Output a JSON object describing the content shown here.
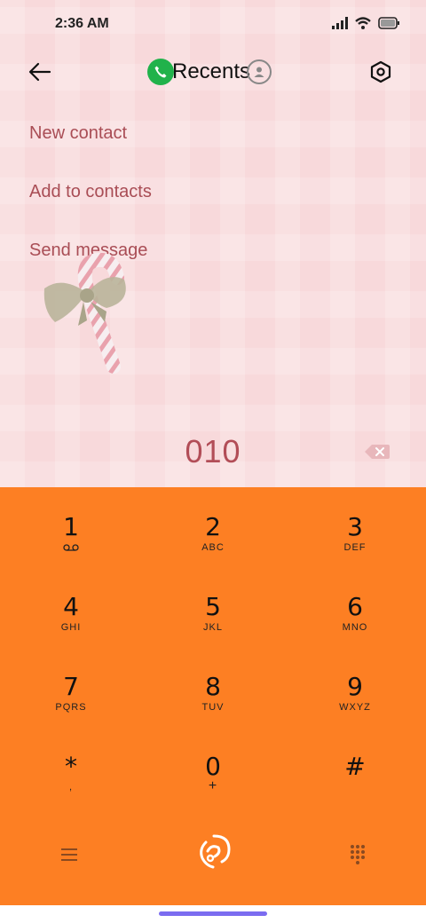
{
  "status": {
    "time": "2:36 AM"
  },
  "toolbar": {
    "title": "Recents"
  },
  "menu": {
    "items": [
      "New contact",
      "Add to contacts",
      "Send message"
    ]
  },
  "dialer": {
    "number": "010"
  },
  "keypad": {
    "keys": [
      {
        "digit": "1",
        "letters": ""
      },
      {
        "digit": "2",
        "letters": "ABC"
      },
      {
        "digit": "3",
        "letters": "DEF"
      },
      {
        "digit": "4",
        "letters": "GHI"
      },
      {
        "digit": "5",
        "letters": "JKL"
      },
      {
        "digit": "6",
        "letters": "MNO"
      },
      {
        "digit": "7",
        "letters": "PQRS"
      },
      {
        "digit": "8",
        "letters": "TUV"
      },
      {
        "digit": "9",
        "letters": "WXYZ"
      },
      {
        "digit": "*",
        "letters": ","
      },
      {
        "digit": "0",
        "letters": "+"
      },
      {
        "digit": "#",
        "letters": ""
      }
    ]
  },
  "colors": {
    "keypad_bg": "#fd7f23",
    "accent_text": "#a94d55",
    "call_badge": "#21b24b",
    "home_bar": "#7b6cf0"
  }
}
